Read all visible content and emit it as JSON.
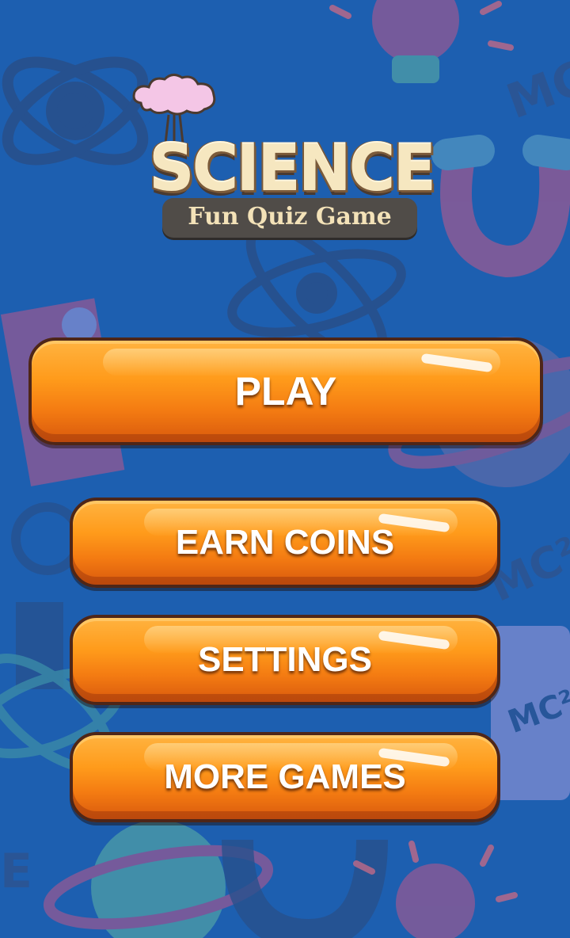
{
  "colors": {
    "background": "#1d5fb0",
    "button_orange": "#ff9b1b",
    "button_border": "#4e2618",
    "logo_cream": "#f6e7c0",
    "banner_gray": "#504c48"
  },
  "logo": {
    "title": "SCIENCE",
    "subtitle": "Fun Quiz Game",
    "icon": "explosion-cloud-icon"
  },
  "menu": {
    "play": "PLAY",
    "earn_coins": "EARN COINS",
    "settings": "SETTINGS",
    "more_games": "MORE GAMES"
  }
}
